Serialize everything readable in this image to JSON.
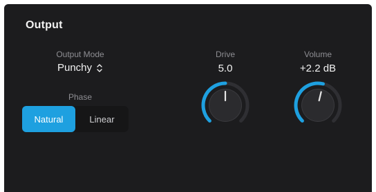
{
  "section": {
    "title": "Output"
  },
  "output_mode": {
    "label": "Output Mode",
    "value": "Punchy"
  },
  "phase": {
    "label": "Phase",
    "options": [
      "Natural",
      "Linear"
    ],
    "selected": "Natural"
  },
  "drive": {
    "label": "Drive",
    "value": "5.0",
    "fraction": 0.5
  },
  "volume": {
    "label": "Volume",
    "value": "+2.2 dB",
    "fraction": 0.55
  },
  "colors": {
    "accent": "#1ea0e0",
    "panel": "#1c1c1e",
    "text": "#f2f2f2",
    "muted": "#8e8e93"
  }
}
